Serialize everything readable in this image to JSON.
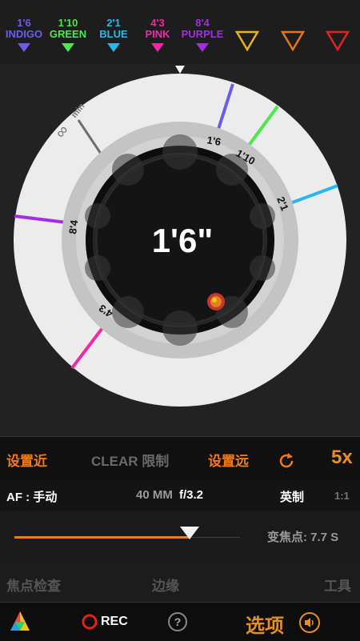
{
  "markers": [
    {
      "value": "1'6",
      "name": "INDIGO",
      "color": "#6a5cf0"
    },
    {
      "value": "1'10",
      "name": "GREEN",
      "color": "#4ce84c"
    },
    {
      "value": "2'1",
      "name": "BLUE",
      "color": "#29b8ee"
    },
    {
      "value": "4'3",
      "name": "PINK",
      "color": "#ee2aa8"
    },
    {
      "value": "8'4",
      "name": "PURPLE",
      "color": "#a22ee0"
    }
  ],
  "outline_markers": [
    {
      "icon": "outline-triangle-yellow-icon",
      "color": "#e8b21a"
    },
    {
      "icon": "outline-triangle-orange-icon",
      "color": "#e8751a"
    },
    {
      "icon": "outline-triangle-red-icon",
      "color": "#e02424"
    }
  ],
  "dial": {
    "center_value": "1'6\"",
    "min_label": "min",
    "infinity_label": "∞",
    "labels": {
      "l16": "1'6",
      "l110": "1'10",
      "l21": "2'1",
      "l84": "8'4",
      "l43": "4'3"
    }
  },
  "controls": {
    "set_near": "设置近",
    "clear_limits": "CLEAR 限制",
    "set_far": "设置远",
    "zoom": "5x"
  },
  "lens": {
    "af_mode": "AF : 手动",
    "focal_length": "40 MM",
    "aperture": "f/3.2",
    "units": "英制",
    "ratio": "1:1"
  },
  "focus": {
    "slider_value": 0.775,
    "focus_time": "变焦点: 7.7 S"
  },
  "tabs": {
    "peaking": "焦点检查",
    "edges": "边缘",
    "tools": "工具"
  },
  "bottom": {
    "rec": "REC",
    "help": "?",
    "options": "选项"
  },
  "colors": {
    "accent": "#f07a1a"
  }
}
